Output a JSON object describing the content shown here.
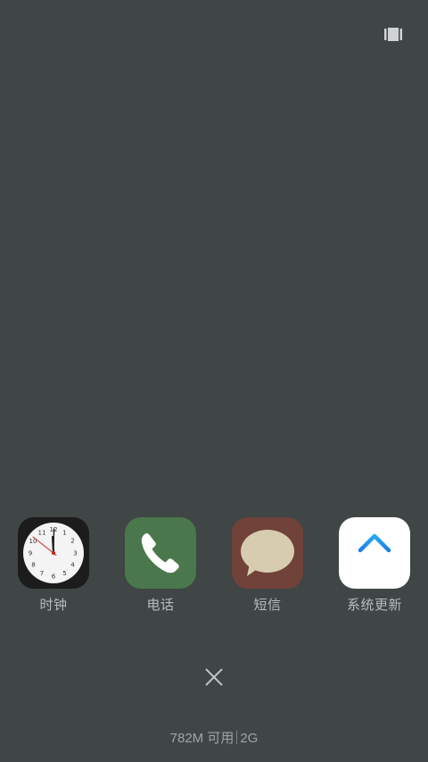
{
  "recent_apps": [
    {
      "label": "时钟",
      "icon": "clock-icon"
    },
    {
      "label": "电话",
      "icon": "phone-icon"
    },
    {
      "label": "短信",
      "icon": "message-bubble-icon"
    },
    {
      "label": "系统更新",
      "icon": "up-arrow-icon"
    }
  ],
  "clock_face_numbers": [
    "12",
    "1",
    "2",
    "3",
    "4",
    "5",
    "6",
    "7",
    "8",
    "9",
    "10",
    "11"
  ],
  "memory": {
    "free": "782M 可用",
    "total": "2G"
  },
  "icons": {
    "multiwindow": "multi-window-icon",
    "close": "close-icon"
  },
  "colors": {
    "background": "#404545",
    "phone": "#4a774c",
    "sms": "#70423a",
    "update_arrow": "#2196f3"
  }
}
